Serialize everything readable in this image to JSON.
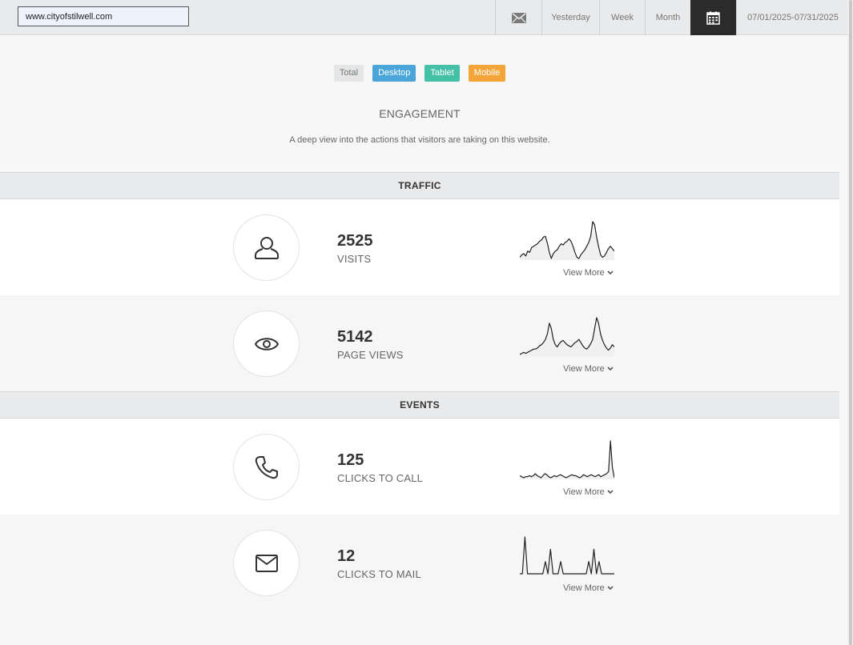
{
  "header": {
    "url_value": "www.cityofstilwell.com",
    "toolbar": {
      "mail_icon": "envelope-icon",
      "yesterday": "Yesterday",
      "week": "Week",
      "month": "Month",
      "calendar_icon": "calendar-icon",
      "date_range": "07/01/2025-07/31/2025"
    }
  },
  "filters": {
    "total": "Total",
    "desktop": "Desktop",
    "tablet": "Tablet",
    "mobile": "Mobile"
  },
  "colors": {
    "desktop": "#4aa6d9",
    "tablet": "#43c0a6",
    "mobile": "#f4a53a",
    "calendar_button": "#2b2b2b"
  },
  "page": {
    "title": "ENGAGEMENT",
    "subtitle": "A deep view into the actions that visitors are taking on this website."
  },
  "sections": {
    "traffic": "TRAFFIC",
    "events": "EVENTS"
  },
  "metrics": [
    {
      "value": "2525",
      "label": "VISITS",
      "icon": "user-icon",
      "link": "View More",
      "trend": [
        62,
        66,
        68,
        64,
        72,
        70,
        78,
        80,
        82,
        84,
        88,
        90,
        95,
        96,
        85,
        70,
        60,
        68,
        72,
        74,
        80,
        84,
        82,
        86,
        88,
        92,
        88,
        80,
        70,
        62,
        60,
        66,
        70,
        74,
        80,
        86,
        96,
        120,
        115,
        95,
        80,
        66,
        62,
        64,
        70,
        76,
        80,
        76,
        72
      ]
    },
    {
      "value": "5142",
      "label": "PAGE VIEWS",
      "icon": "eye-icon",
      "link": "View More",
      "trend": [
        62,
        64,
        66,
        64,
        66,
        68,
        70,
        72,
        72,
        74,
        78,
        80,
        84,
        90,
        100,
        120,
        110,
        90,
        80,
        76,
        82,
        86,
        88,
        84,
        80,
        78,
        76,
        80,
        84,
        86,
        90,
        84,
        78,
        74,
        72,
        76,
        82,
        90,
        110,
        130,
        120,
        100,
        88,
        80,
        74,
        70,
        74,
        80,
        76
      ]
    },
    {
      "value": "125",
      "label": "CLICKS TO CALL",
      "icon": "phone-icon",
      "link": "View More",
      "trend": [
        6,
        5,
        4,
        5,
        5,
        6,
        5,
        6,
        8,
        6,
        5,
        4,
        6,
        8,
        7,
        5,
        4,
        5,
        6,
        5,
        6,
        7,
        6,
        5,
        4,
        5,
        6,
        7,
        6,
        6,
        5,
        4,
        5,
        7,
        6,
        5,
        6,
        7,
        6,
        5,
        6,
        7,
        5,
        6,
        7,
        8,
        10,
        40,
        14,
        4
      ]
    },
    {
      "value": "12",
      "label": "CLICKS TO MAIL",
      "icon": "envelope-icon",
      "link": "View More",
      "trend": [
        0,
        0,
        3,
        0,
        0,
        0,
        0,
        0,
        0,
        0,
        1,
        0,
        2,
        0,
        0,
        0,
        1,
        0,
        0,
        0,
        0,
        0,
        0,
        0,
        0,
        0,
        0,
        1,
        0,
        2,
        0,
        1,
        0,
        0,
        0,
        0,
        0,
        0
      ]
    }
  ]
}
